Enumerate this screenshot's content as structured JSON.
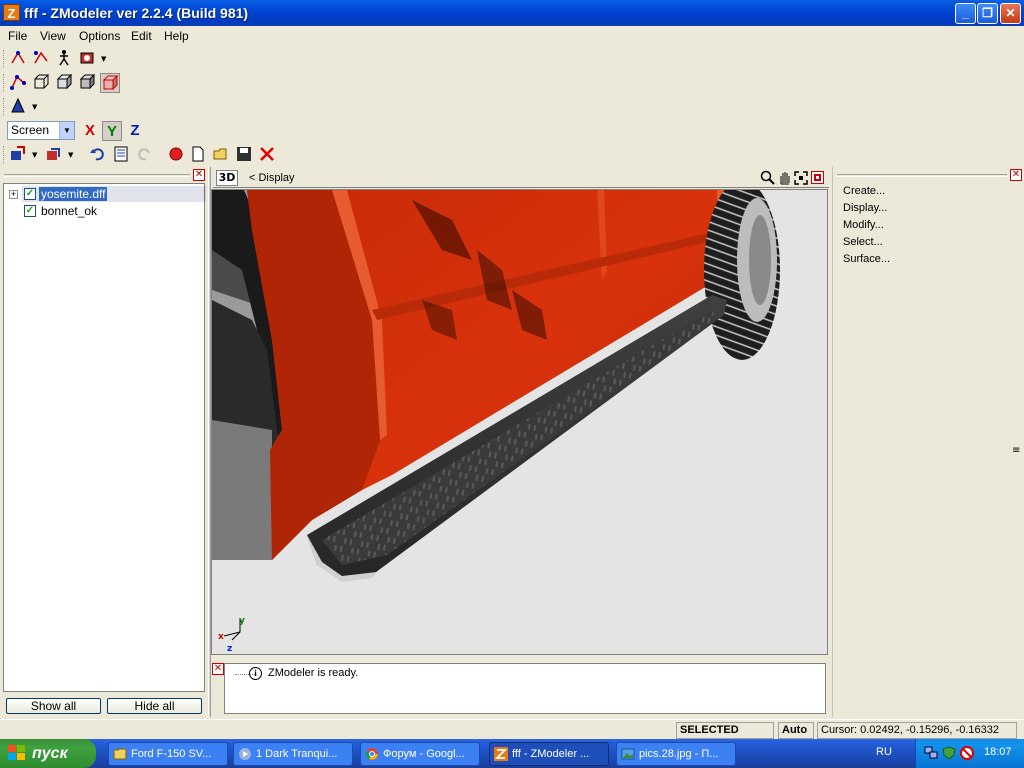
{
  "window": {
    "app_icon_letter": "Z",
    "title": "fff - ZModeler ver 2.2.4 (Build 981)",
    "min_btn": "_",
    "max_btn": "❐",
    "close_btn": "✕"
  },
  "menu": {
    "items": [
      "File",
      "View",
      "Options",
      "Edit",
      "Help"
    ]
  },
  "toolbar": {
    "coord_system": "Screen",
    "axes": [
      "X",
      "Y",
      "Z"
    ]
  },
  "scene_tree": {
    "items": [
      {
        "label": "yosemite.dff",
        "checked": true,
        "selected": true,
        "expandable": true
      },
      {
        "label": "bonnet_ok",
        "checked": true,
        "selected": false,
        "expandable": false
      }
    ],
    "show_all_label": "Show all",
    "hide_all_label": "Hide all"
  },
  "viewport": {
    "view_tag": "3D",
    "breadcrumb": "<  Display",
    "gizmo": {
      "x": "x",
      "y": "y",
      "z": "z"
    }
  },
  "log": {
    "message": "ZModeler is ready."
  },
  "command_panel": {
    "items": [
      "Create...",
      "Display...",
      "Modify...",
      "Select...",
      "Surface..."
    ]
  },
  "status": {
    "mode": "SELECTED MODE",
    "auto": "Auto",
    "cursor": "Cursor: 0.02492, -0.15296, -0.16332"
  },
  "taskbar": {
    "start_label": "пуск",
    "tasks": [
      {
        "label": "Ford F-150 SV...",
        "active": false
      },
      {
        "label": "1 Dark Tranqui...",
        "active": false
      },
      {
        "label": "Форум - Googl...",
        "active": false
      },
      {
        "label": "fff - ZModeler ...",
        "active": true
      },
      {
        "label": "pics.28.jpg - П...",
        "active": false
      }
    ],
    "language": "RU",
    "clock": "18:07"
  },
  "colors": {
    "car_body": "#d8320c",
    "xp_blue": "#245edb",
    "start_green": "#3ea13e"
  }
}
